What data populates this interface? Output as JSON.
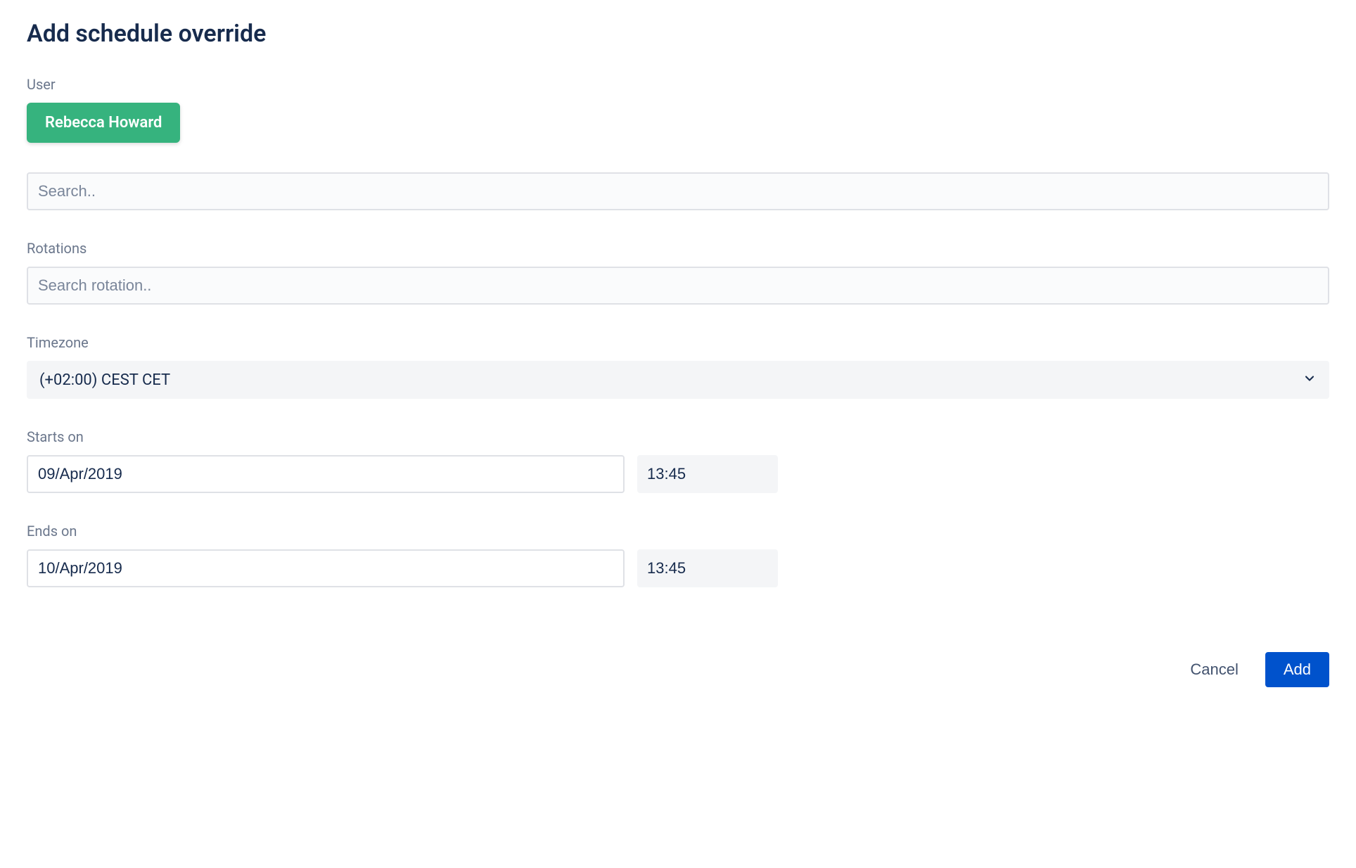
{
  "title": "Add schedule override",
  "user": {
    "label": "User",
    "selected": "Rebecca Howard",
    "search_placeholder": "Search.."
  },
  "rotations": {
    "label": "Rotations",
    "search_placeholder": "Search rotation.."
  },
  "timezone": {
    "label": "Timezone",
    "value": "(+02:00) CEST CET"
  },
  "starts": {
    "label": "Starts on",
    "date": "09/Apr/2019",
    "time": "13:45"
  },
  "ends": {
    "label": "Ends on",
    "date": "10/Apr/2019",
    "time": "13:45"
  },
  "footer": {
    "cancel": "Cancel",
    "add": "Add"
  }
}
